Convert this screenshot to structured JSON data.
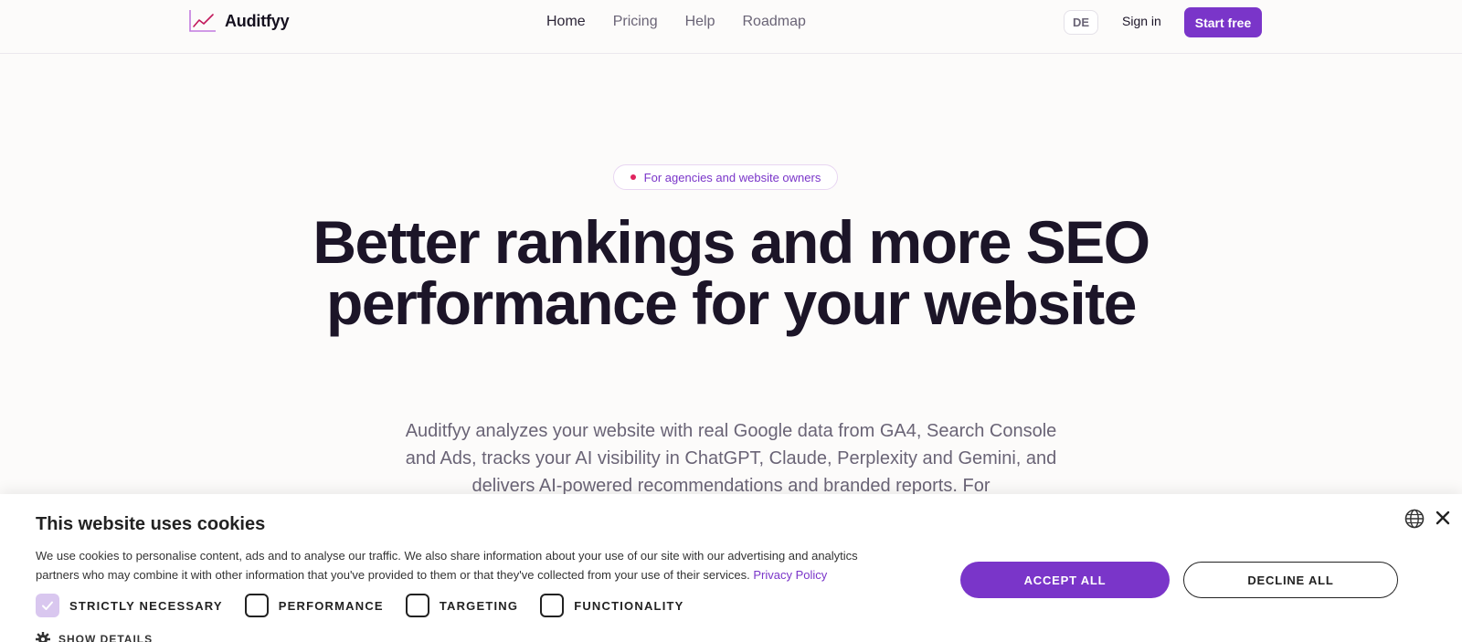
{
  "header": {
    "logo_text": "Auditfyy",
    "nav": [
      {
        "label": "Home"
      },
      {
        "label": "Pricing"
      },
      {
        "label": "Help"
      },
      {
        "label": "Roadmap"
      }
    ],
    "language": "DE",
    "sign_in": "Sign in",
    "start_free": "Start free"
  },
  "hero": {
    "badge": "For agencies and website owners",
    "title": "Better rankings and more SEO performance for your website",
    "subtitle": "Auditfyy analyzes your website with real Google data from GA4, Search Console and Ads, tracks your AI visibility in ChatGPT, Claude, Perplexity and Gemini, and delivers AI-powered recommendations and branded reports. For"
  },
  "cookie_banner": {
    "title": "This website uses cookies",
    "text": "We use cookies to personalise content, ads and to analyse our traffic. We also share information about your use of our site with our advertising and analytics partners who may combine it with other information that you've provided to them or that they've collected from your use of their services.",
    "privacy_link": "Privacy Policy",
    "options": [
      {
        "label": "STRICTLY NECESSARY",
        "checked": true
      },
      {
        "label": "PERFORMANCE",
        "checked": false
      },
      {
        "label": "TARGETING",
        "checked": false
      },
      {
        "label": "FUNCTIONALITY",
        "checked": false
      }
    ],
    "show_details": "SHOW DETAILS",
    "accept_all": "ACCEPT ALL",
    "decline_all": "DECLINE ALL"
  },
  "colors": {
    "accent": "#7a35c9",
    "badge_dot": "#e0245e",
    "background": "#fcfbfa"
  }
}
